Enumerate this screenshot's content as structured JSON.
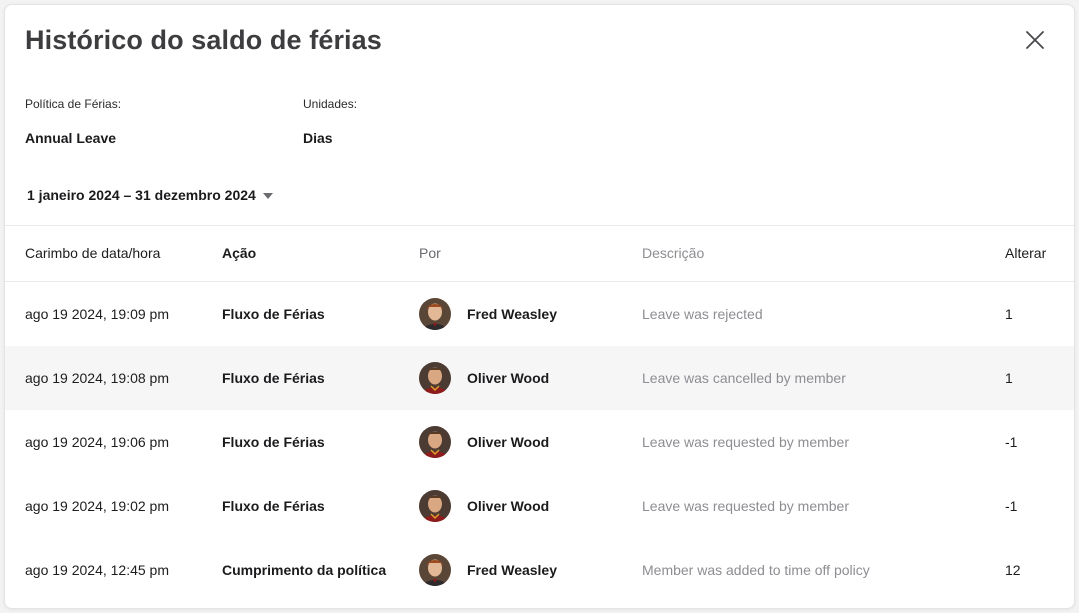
{
  "dialog": {
    "title": "Histórico do saldo de férias",
    "policy_label": "Política de Férias:",
    "policy_value": "Annual Leave",
    "units_label": "Unidades:",
    "units_value": "Dias",
    "date_range": "1 janeiro 2024 – 31 dezembro 2024"
  },
  "table": {
    "headers": {
      "timestamp": "Carimbo de data/hora",
      "action": "Ação",
      "by": "Por",
      "description": "Descrição",
      "change": "Alterar"
    },
    "rows": [
      {
        "timestamp": "ago 19 2024, 19:09 pm",
        "action": "Fluxo de Férias",
        "by": "Fred Weasley",
        "description": "Leave was rejected",
        "change": "1"
      },
      {
        "timestamp": "ago 19 2024, 19:08 pm",
        "action": "Fluxo de Férias",
        "by": "Oliver Wood",
        "description": "Leave was cancelled by member",
        "change": "1"
      },
      {
        "timestamp": "ago 19 2024, 19:06 pm",
        "action": "Fluxo de Férias",
        "by": "Oliver Wood",
        "description": "Leave was requested by member",
        "change": "-1"
      },
      {
        "timestamp": "ago 19 2024, 19:02 pm",
        "action": "Fluxo de Férias",
        "by": "Oliver Wood",
        "description": "Leave was requested by member",
        "change": "-1"
      },
      {
        "timestamp": "ago 19 2024, 12:45 pm",
        "action": "Cumprimento da política",
        "by": "Fred Weasley",
        "description": "Member was added to time off policy",
        "change": "12"
      }
    ]
  },
  "icons": {
    "close": "close-icon",
    "dropdown": "chevron-down-icon",
    "avatar": "user-avatar"
  },
  "colors": {
    "row_highlight": "#f6f6f7",
    "muted_text": "#8d8d92"
  }
}
